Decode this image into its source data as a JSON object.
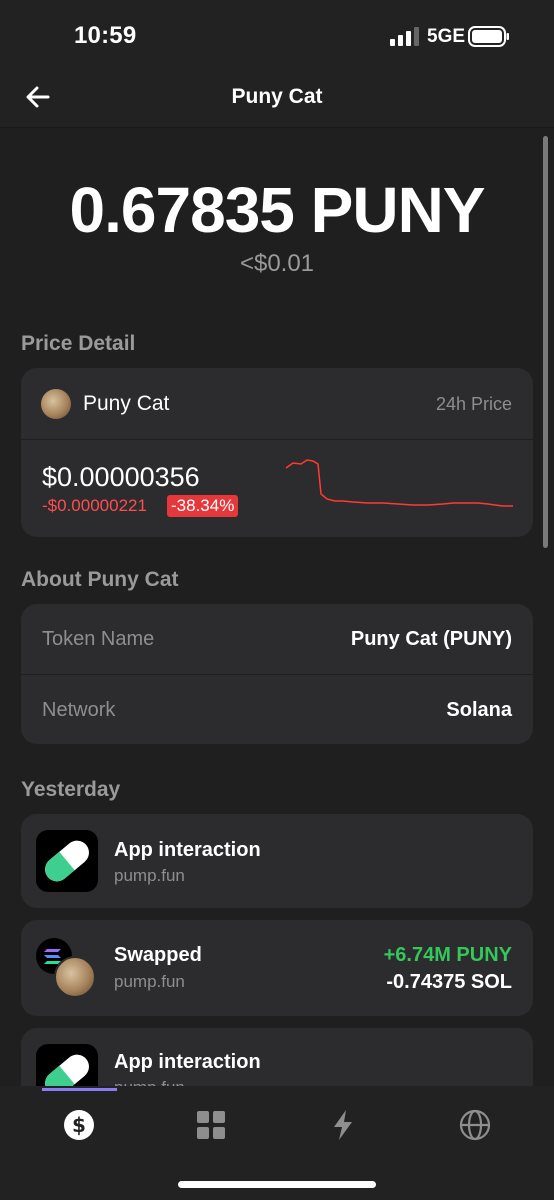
{
  "status_bar": {
    "time": "10:59",
    "network": "5GE"
  },
  "header": {
    "title": "Puny Cat",
    "back_icon": "arrow-left-icon"
  },
  "balance": {
    "amount": "0.67835 PUNY",
    "usd": "<$0.01"
  },
  "price_detail": {
    "section_label": "Price Detail",
    "coin_name": "Puny Cat",
    "period_label": "24h Price",
    "price": "$0.00000356",
    "change": "-$0.00000221",
    "change_pct": "-38.34%",
    "sparkline_color": "#ff3b30"
  },
  "about": {
    "section_label": "About Puny Cat",
    "rows": [
      {
        "key": "Token Name",
        "value": "Puny Cat (PUNY)"
      },
      {
        "key": "Network",
        "value": "Solana"
      }
    ]
  },
  "activity": {
    "section_label": "Yesterday",
    "items": [
      {
        "title": "App interaction",
        "subtitle": "pump.fun",
        "icon": "pill-icon"
      },
      {
        "title": "Swapped",
        "subtitle": "pump.fun",
        "amount_in": "+6.74M PUNY",
        "amount_out": "-0.74375 SOL",
        "icon": "swap-icon"
      },
      {
        "title": "App interaction",
        "subtitle": "pump.fun",
        "icon": "pill-icon"
      }
    ]
  },
  "tab_bar": {
    "tabs": [
      {
        "name": "tab-wallet",
        "icon": "dollar-icon",
        "active": true
      },
      {
        "name": "tab-collectibles",
        "icon": "grid-icon",
        "active": false
      },
      {
        "name": "tab-activity",
        "icon": "lightning-icon",
        "active": false
      },
      {
        "name": "tab-explore",
        "icon": "globe-icon",
        "active": false
      }
    ]
  },
  "colors": {
    "background": "#1f1f1f",
    "card": "#2c2c2e",
    "positive": "#34c759",
    "negative": "#ff4d4f"
  }
}
